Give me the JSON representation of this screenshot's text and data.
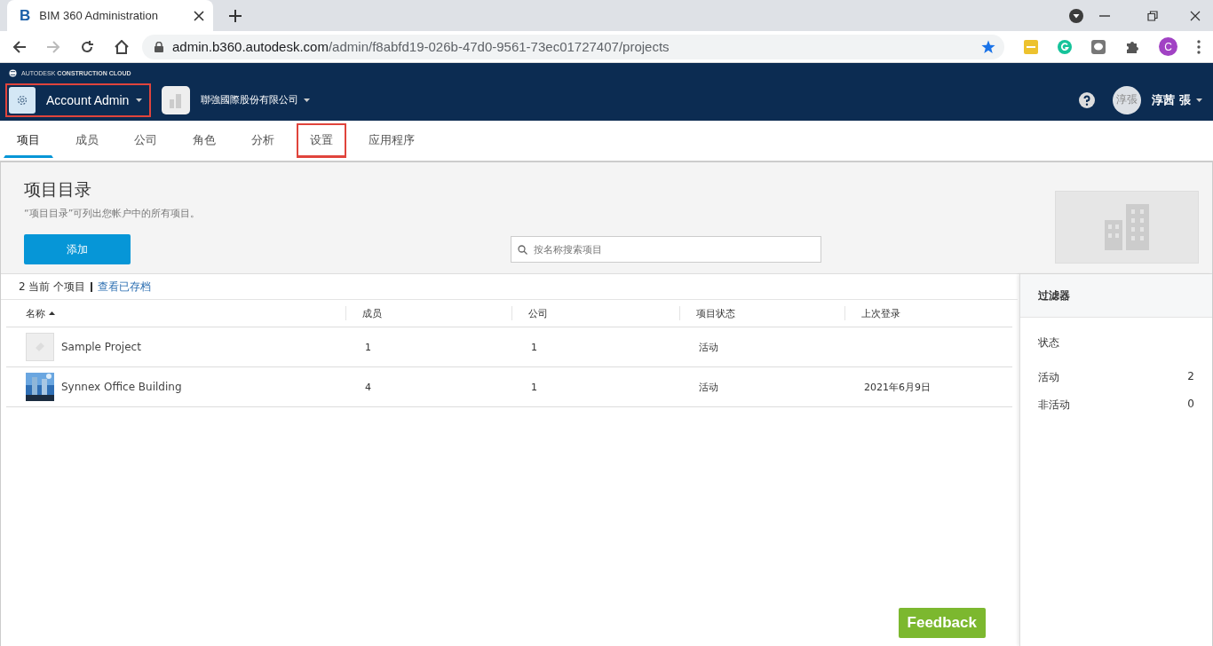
{
  "browser": {
    "favicon": "B",
    "tab_title": "BIM 360 Administration",
    "url_host": "admin.b360.autodesk.com",
    "url_path": "/admin/f8abfd19-026b-47d0-9561-73ec01727407/projects",
    "profile_initial": "C"
  },
  "header": {
    "brand": "AUTODESK",
    "brand_sub": "CONSTRUCTION CLOUD",
    "module": "Account Admin",
    "module_highlighted": true,
    "account": "聯強國際股份有限公司",
    "avatar_text": "淳張",
    "user_name": "淳茜 張"
  },
  "tabs": [
    {
      "label": "项目",
      "selected": true,
      "highlighted": false
    },
    {
      "label": "成员",
      "selected": false,
      "highlighted": false
    },
    {
      "label": "公司",
      "selected": false,
      "highlighted": false
    },
    {
      "label": "角色",
      "selected": false,
      "highlighted": false
    },
    {
      "label": "分析",
      "selected": false,
      "highlighted": false
    },
    {
      "label": "设置",
      "selected": false,
      "highlighted": true
    },
    {
      "label": "应用程序",
      "selected": false,
      "highlighted": false
    }
  ],
  "directory": {
    "title": "项目目录",
    "description": "“项目目录”可列出您帐户中的所有项目。",
    "add_button": "添加",
    "search_placeholder": "按名称搜索项目"
  },
  "list": {
    "count": "2 当前 个项目",
    "archive_link": "查看已存档",
    "columns": [
      "名称",
      "成员",
      "公司",
      "项目状态",
      "上次登录"
    ],
    "rows": [
      {
        "kind": "placeholder",
        "name": "Sample Project",
        "members": "1",
        "companies": "1",
        "status": "活动",
        "last_login": ""
      },
      {
        "kind": "picture",
        "name": "Synnex Office Building",
        "members": "4",
        "companies": "1",
        "status": "活动",
        "last_login": "2021年6月9日"
      }
    ]
  },
  "filter": {
    "title": "过滤器",
    "section": "状态",
    "items": [
      {
        "label": "活动",
        "count": "2"
      },
      {
        "label": "非活动",
        "count": "0"
      }
    ]
  },
  "feedback_button": "Feedback"
}
